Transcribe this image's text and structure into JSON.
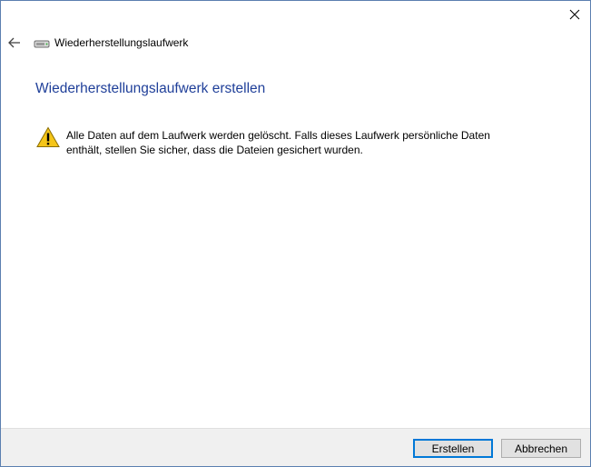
{
  "window": {
    "close_glyph": "✕"
  },
  "nav": {
    "back_glyph": "←",
    "title": "Wiederherstellungslaufwerk"
  },
  "main": {
    "heading": "Wiederherstellungslaufwerk erstellen",
    "warning_line1": "Alle Daten auf dem Laufwerk werden gelöscht. Falls dieses Laufwerk persönliche Daten",
    "warning_line2": "enthält, stellen Sie sicher, dass die Dateien gesichert wurden."
  },
  "footer": {
    "create_label": "Erstellen",
    "cancel_label": "Abbrechen"
  },
  "icons": {
    "close": "close-icon",
    "back": "arrow-left-icon",
    "drive": "drive-icon",
    "warning": "warning-icon"
  },
  "colors": {
    "heading": "#1f3f99",
    "window_border": "#5b7fb0",
    "footer_bg": "#f0f0f0",
    "primary_button_border": "#0078d7",
    "warning_fill": "#f5c518"
  }
}
